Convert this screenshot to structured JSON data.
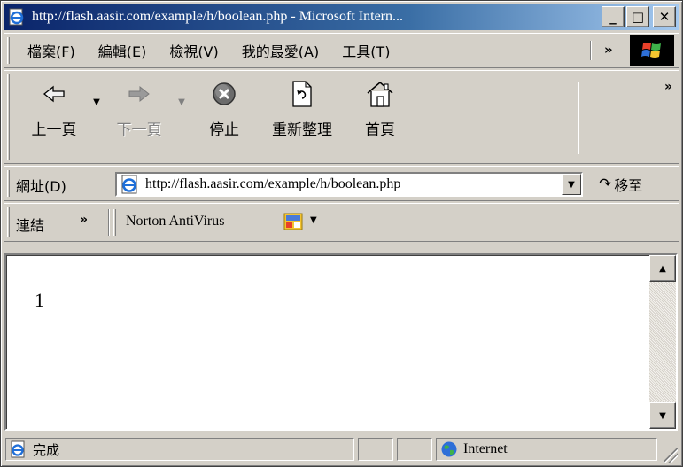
{
  "window": {
    "title": "http://flash.aasir.com/example/h/boolean.php - Microsoft Intern...",
    "minimize_glyph": "_",
    "maximize_glyph": "□",
    "close_glyph": "✕"
  },
  "menu": {
    "items": [
      "檔案(F)",
      "編輯(E)",
      "檢視(V)",
      "我的最愛(A)",
      "工具(T)"
    ],
    "more_glyph": "»"
  },
  "toolbar": {
    "back_label": "上一頁",
    "forward_label": "下一頁",
    "stop_label": "停止",
    "refresh_label": "重新整理",
    "home_label": "首頁",
    "more_glyph": "»",
    "forward_enabled": false
  },
  "address": {
    "label": "網址(D)",
    "url": "http://flash.aasir.com/example/h/boolean.php",
    "go_label": "移至",
    "go_glyph": "↷"
  },
  "links": {
    "label": "連結",
    "more_glyph": "»",
    "items": [
      "Norton AntiVirus"
    ]
  },
  "content": {
    "body_text": "1"
  },
  "status": {
    "text": "完成",
    "zone": "Internet"
  },
  "icons": {
    "title": "ie-page-icon",
    "back": "back-arrow-icon",
    "forward": "forward-arrow-icon",
    "stop": "stop-icon",
    "refresh": "refresh-icon",
    "home": "home-icon",
    "address": "ie-page-icon",
    "go": "go-arrow-icon",
    "norton": "norton-antivirus-icon",
    "status": "ie-page-icon",
    "zone": "internet-globe-icon"
  },
  "colors": {
    "chrome": "#d4d0c8",
    "titlebar_start": "#0a246a",
    "titlebar_end": "#a6caf0",
    "content_bg": "#ffffff"
  }
}
